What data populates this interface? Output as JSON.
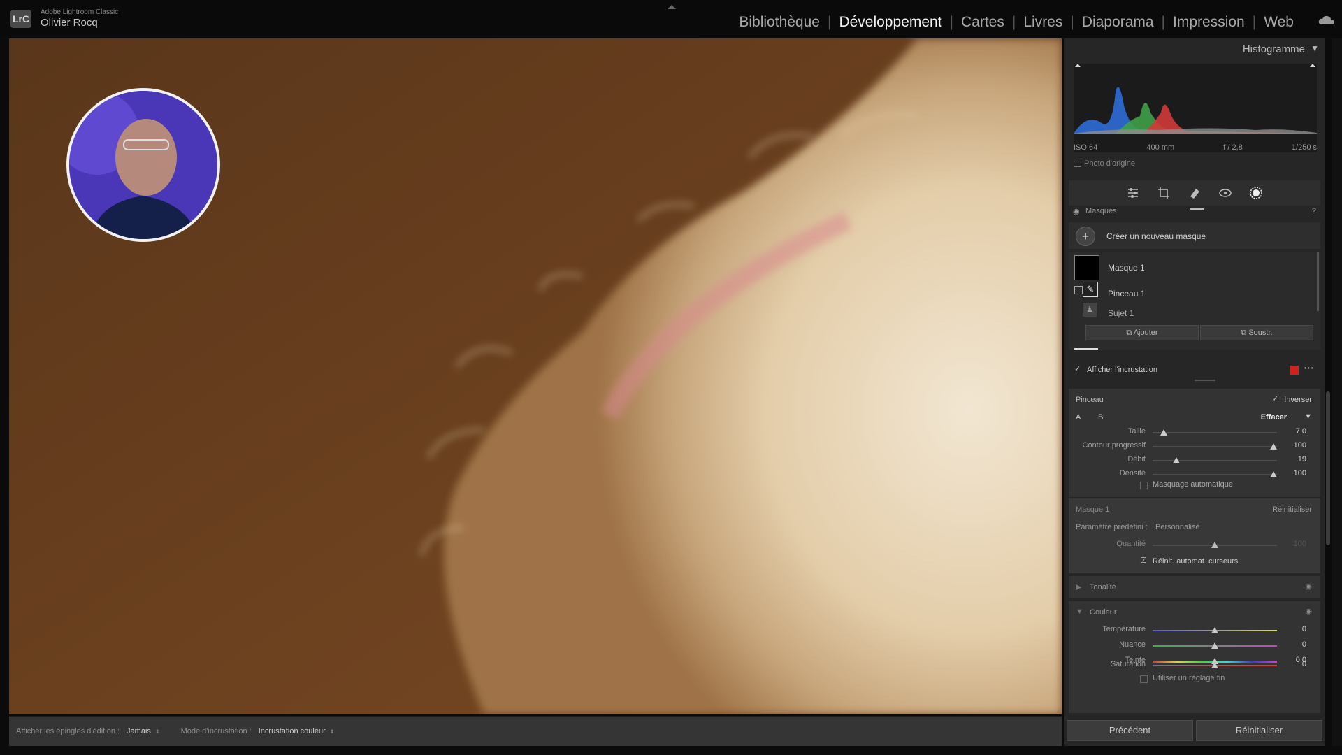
{
  "app": {
    "logo": "LrC",
    "name": "Adobe Lightroom Classic",
    "user": "Olivier Rocq"
  },
  "modules": [
    {
      "label": "Bibliothèque",
      "active": false
    },
    {
      "label": "Développement",
      "active": true
    },
    {
      "label": "Cartes",
      "active": false
    },
    {
      "label": "Livres",
      "active": false
    },
    {
      "label": "Diaporama",
      "active": false
    },
    {
      "label": "Impression",
      "active": false
    },
    {
      "label": "Web",
      "active": false
    }
  ],
  "bottom_toolbar": {
    "pins_label": "Afficher les épingles d'édition :",
    "pins_value": "Jamais",
    "overlay_mode_label": "Mode d'incrustation :",
    "overlay_mode_value": "Incrustation couleur"
  },
  "histogram": {
    "title": "Histogramme",
    "info": [
      "ISO 64",
      "400 mm",
      "f / 2,8",
      "1/250 s"
    ],
    "original_photo": "Photo d'origine"
  },
  "masks": {
    "title": "Masques",
    "create": "Créer un nouveau masque",
    "items": [
      {
        "label": "Masque 1"
      },
      {
        "label": "Pinceau 1"
      },
      {
        "label": "Sujet 1"
      }
    ],
    "add": "Ajouter",
    "subtract": "Soustr.",
    "show_overlay": "Afficher l'incrustation",
    "overlay_color": "#d3201b"
  },
  "brush": {
    "title": "Pinceau",
    "invert": "Inverser",
    "a": "A",
    "b": "B",
    "mode": "Effacer",
    "sliders": [
      {
        "label": "Taille",
        "value": "7,0",
        "pos": 0.09
      },
      {
        "label": "Contour progressif",
        "value": "100",
        "pos": 0.97
      },
      {
        "label": "Débit",
        "value": "19",
        "pos": 0.19
      },
      {
        "label": "Densité",
        "value": "100",
        "pos": 0.97
      }
    ],
    "auto_mask": "Masquage automatique"
  },
  "mask_settings": {
    "title": "Masque 1",
    "reset": "Réinitialiser",
    "preset_label": "Paramètre prédéfini :",
    "preset_value": "Personnalisé",
    "amount_label": "Quantité",
    "amount_value": "100",
    "auto_reset": "Réinit. automat. curseurs"
  },
  "tone": {
    "title": "Tonalité"
  },
  "color": {
    "title": "Couleur",
    "sliders": [
      {
        "label": "Température",
        "value": "0",
        "pos": 0.5
      },
      {
        "label": "Nuance",
        "value": "0",
        "pos": 0.5
      },
      {
        "label": "Teinte",
        "value": "0,0",
        "pos": 0.5
      },
      {
        "label": "Saturation",
        "value": "0",
        "pos": 0.5
      }
    ],
    "fine_adjust": "Utiliser un réglage fin"
  },
  "footer": {
    "previous": "Précédent",
    "reset": "Réinitialiser"
  }
}
